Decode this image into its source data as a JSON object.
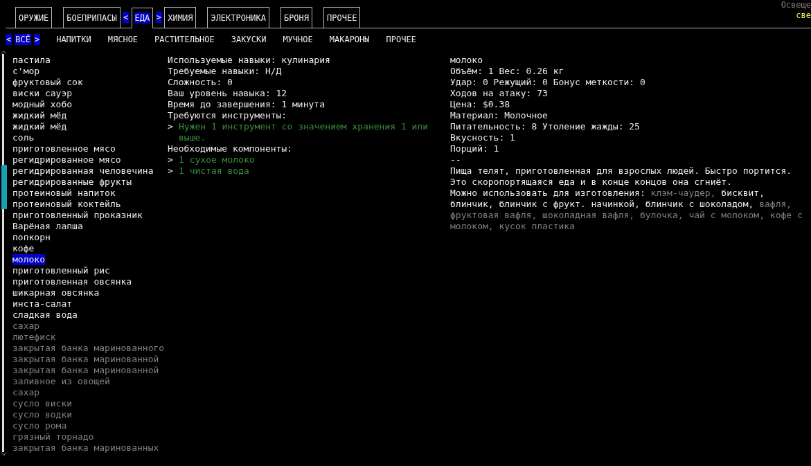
{
  "categories": {
    "prev_marker": "<",
    "next_marker": ">",
    "items": [
      {
        "label": "ОРУЖИЕ",
        "selected": false
      },
      {
        "label": "БОЕПРИПАСЫ",
        "selected": false
      },
      {
        "label": "ЕДА",
        "selected": true
      },
      {
        "label": "ХИМИЯ",
        "selected": false
      },
      {
        "label": "ЭЛЕКТРОНИКА",
        "selected": false
      },
      {
        "label": "БРОНЯ",
        "selected": false
      },
      {
        "label": "ПРОЧЕЕ",
        "selected": false
      }
    ]
  },
  "corner": {
    "label": "Освеще",
    "value": "све"
  },
  "subcategories": {
    "prev_marker": "<",
    "next_marker": ">",
    "items": [
      {
        "label": "ВСЁ",
        "selected": true
      },
      {
        "label": "НАПИТКИ",
        "selected": false
      },
      {
        "label": "МЯСНОЕ",
        "selected": false
      },
      {
        "label": "РАСТИТЕЛЬНОЕ",
        "selected": false
      },
      {
        "label": "ЗАКУСКИ",
        "selected": false
      },
      {
        "label": "МУЧНОЕ",
        "selected": false
      },
      {
        "label": "МАКАРОНЫ",
        "selected": false
      },
      {
        "label": "ПРОЧЕЕ",
        "selected": false
      }
    ]
  },
  "recipes": [
    {
      "name": "пастила",
      "available": true,
      "selected": false
    },
    {
      "name": "с'мор",
      "available": true,
      "selected": false
    },
    {
      "name": "фруктовый сок",
      "available": true,
      "selected": false
    },
    {
      "name": "виски сауэр",
      "available": true,
      "selected": false
    },
    {
      "name": "модный хобо",
      "available": true,
      "selected": false
    },
    {
      "name": "жидкий мёд",
      "available": true,
      "selected": false
    },
    {
      "name": "жидкий мёд",
      "available": true,
      "selected": false
    },
    {
      "name": "соль",
      "available": true,
      "selected": false
    },
    {
      "name": "приготовленное мясо",
      "available": true,
      "selected": false
    },
    {
      "name": "регидрированное мясо",
      "available": true,
      "selected": false
    },
    {
      "name": "регидрированная человечина",
      "available": true,
      "selected": false
    },
    {
      "name": "регидрированные фрукты",
      "available": true,
      "selected": false
    },
    {
      "name": "протеиновый напиток",
      "available": true,
      "selected": false
    },
    {
      "name": "протеиновый коктейль",
      "available": true,
      "selected": false
    },
    {
      "name": "приготовленный проказник",
      "available": true,
      "selected": false
    },
    {
      "name": "Варёная лапша",
      "available": true,
      "selected": false
    },
    {
      "name": "попкорн",
      "available": true,
      "selected": false
    },
    {
      "name": "кофе",
      "available": true,
      "selected": false
    },
    {
      "name": "молоко",
      "available": true,
      "selected": true
    },
    {
      "name": "приготовленный рис",
      "available": true,
      "selected": false
    },
    {
      "name": "приготовленная овсянка",
      "available": true,
      "selected": false
    },
    {
      "name": "шикарная овсянка",
      "available": true,
      "selected": false
    },
    {
      "name": "инста-салат",
      "available": true,
      "selected": false
    },
    {
      "name": "сладкая вода",
      "available": true,
      "selected": false
    },
    {
      "name": "сахар",
      "available": false,
      "selected": false
    },
    {
      "name": "лютефиск",
      "available": false,
      "selected": false
    },
    {
      "name": "закрытая банка маринованного",
      "available": false,
      "selected": false
    },
    {
      "name": "закрытая банка маринованной",
      "available": false,
      "selected": false
    },
    {
      "name": "закрытая банка маринованной",
      "available": false,
      "selected": false
    },
    {
      "name": "заливное из овощей",
      "available": false,
      "selected": false
    },
    {
      "name": "сахар",
      "available": false,
      "selected": false
    },
    {
      "name": "сусло виски",
      "available": false,
      "selected": false
    },
    {
      "name": "сусло водки",
      "available": false,
      "selected": false
    },
    {
      "name": "сусло рома",
      "available": false,
      "selected": false
    },
    {
      "name": "грязный торнадо",
      "available": false,
      "selected": false
    },
    {
      "name": "закрытая банка маринованных",
      "available": false,
      "selected": false
    }
  ],
  "recipe_details": [
    {
      "kind": "line",
      "text": "Используемые навыки: кулинария"
    },
    {
      "kind": "line",
      "text": "Требуемые навыки: Н/Д"
    },
    {
      "kind": "line",
      "text": "Сложность: 0"
    },
    {
      "kind": "line",
      "text": "Ваш уровень навыка: 12"
    },
    {
      "kind": "line",
      "text": "Время до завершения: 1 минута"
    },
    {
      "kind": "line",
      "text": "Требуются инструменты:"
    },
    {
      "kind": "requirement",
      "marker": ">",
      "text": "Нужен 1 инструмент со значением хранения 1 или выше."
    },
    {
      "kind": "line",
      "text": "Необходимые компоненты:"
    },
    {
      "kind": "requirement",
      "marker": ">",
      "text": "1 сухое молоко"
    },
    {
      "kind": "requirement",
      "marker": ">",
      "text": "1 чистая вода"
    }
  ],
  "item_info": {
    "lines": [
      "молоко",
      "Объём: 1 Вес: 0.26 кг",
      "Удар: 0 Режущий: 0 Бонус меткости: 0",
      "Ходов на атаку: 73",
      "Цена: $0.38",
      "Материал: Молочное",
      "Питательность: 8 Утоление жажды: 25",
      "Вкусность: 1",
      "Порций: 1",
      "--",
      "Пища телят, приготовленная для взрослых людей. Быстро портится.",
      "Это скоропортящаяся еда и в конце концов она сгниёт."
    ],
    "usage_label": "Можно использовать для изготовления:",
    "usage_lines": [
      [
        {
          "name": "клэм-чаудер,",
          "available": false
        },
        {
          "name": "бисквит,",
          "available": true
        }
      ],
      [
        {
          "name": "блинчик,",
          "available": true
        },
        {
          "name": "блинчик с фрукт. начинкой,",
          "available": true
        },
        {
          "name": "блинчик с шоколадом,",
          "available": true
        },
        {
          "name": "вафля,",
          "available": false
        }
      ],
      [
        {
          "name": "фруктовая вафля,",
          "available": false
        },
        {
          "name": "шоколадная вафля,",
          "available": false
        },
        {
          "name": "булочка,",
          "available": false
        },
        {
          "name": "чай с молоком,",
          "available": false
        },
        {
          "name": "кофе с",
          "available": false
        }
      ],
      [
        {
          "name": "молоком,",
          "available": false
        },
        {
          "name": "кусок пластика",
          "available": false
        }
      ]
    ]
  }
}
